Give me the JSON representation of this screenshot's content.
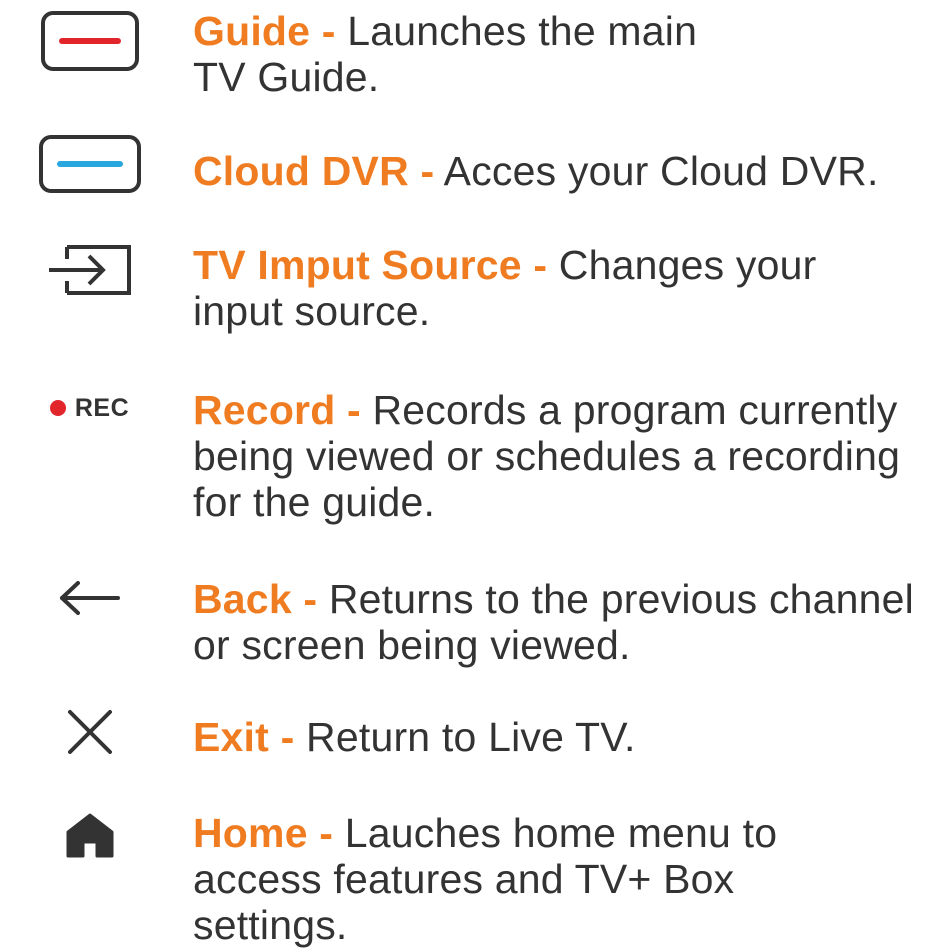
{
  "colors": {
    "accent": "#f07c22",
    "text": "#333333",
    "red_bar": "#e2252b",
    "blue_bar": "#29a8e0",
    "rec_dot": "#e2252b",
    "icon_stroke": "#333333"
  },
  "items": [
    {
      "icon": "guide-button-icon",
      "term": "Guide -",
      "description": " Launches the main TV Guide."
    },
    {
      "icon": "cloud-dvr-button-icon",
      "term": "Cloud DVR -",
      "description": " Acces your Cloud DVR."
    },
    {
      "icon": "input-source-icon",
      "term": "TV Imput Source -",
      "description": " Changes your input source."
    },
    {
      "icon": "record-icon",
      "icon_label": "REC",
      "term": "Record -",
      "description": " Records a program currently being viewed or schedules a recording for the guide."
    },
    {
      "icon": "back-arrow-icon",
      "term": "Back -",
      "description": " Returns to the previous channel or screen being viewed."
    },
    {
      "icon": "close-icon",
      "term": "Exit -",
      "description": " Return to Live TV."
    },
    {
      "icon": "home-icon",
      "term": "Home -",
      "description": " Lauches home menu to access features and TV+ Box settings."
    }
  ]
}
